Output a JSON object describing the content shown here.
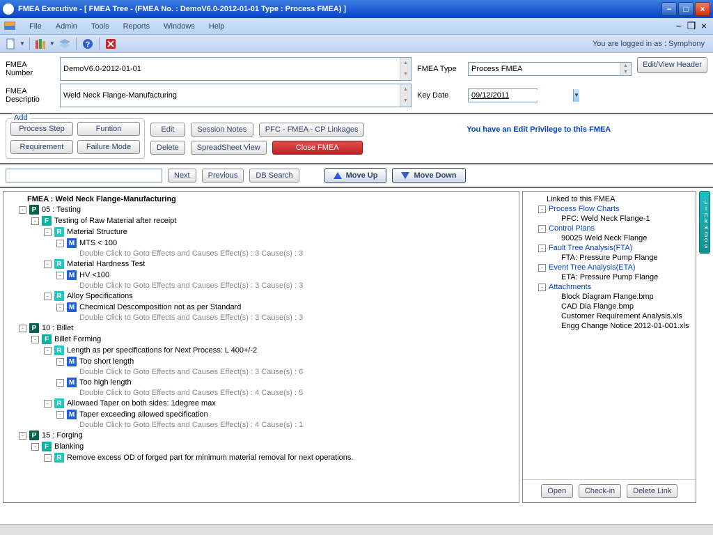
{
  "window": {
    "title": "FMEA Executive - [ FMEA Tree - (FMEA No. : DemoV6.0-2012-01-01  Type : Process FMEA) ]"
  },
  "menu": {
    "items": [
      "File",
      "Admin",
      "Tools",
      "Reports",
      "Windows",
      "Help"
    ]
  },
  "toolbar": {
    "login_status": "You are logged in as : Symphony"
  },
  "header": {
    "labels": {
      "fmea_number": "FMEA Number",
      "fmea_descriptio": "FMEA Descriptio",
      "fmea_type": "FMEA Type",
      "key_date": "Key Date"
    },
    "fmea_number": "DemoV6.0-2012-01-01",
    "fmea_descriptio": "Weld Neck Flange-Manufacturing",
    "fmea_type": "Process FMEA",
    "key_date": "09/12/2011",
    "edit_view_header": "Edit/View Header"
  },
  "actions": {
    "add_legend": "Add",
    "process_step": "Process Step",
    "funtion": "Funtion",
    "requirement": "Requirement",
    "failure_mode": "Failure Mode",
    "edit": "Edit",
    "delete": "Delete",
    "session_notes": "Session Notes",
    "pfc_linkages": "PFC - FMEA - CP Linkages",
    "spreadsheet_view": "SpreadSheet View",
    "close_fmea": "Close FMEA",
    "priv_msg": "You have an Edit Privilege to this FMEA"
  },
  "search": {
    "placeholder": "",
    "next": "Next",
    "previous": "Previous",
    "db_search": "DB Search",
    "move_up": "Move Up",
    "move_down": "Move Down"
  },
  "tree": {
    "root": "FMEA : Weld Neck Flange-Manufacturing",
    "nodes": [
      {
        "pm": "-",
        "ind": 1,
        "b": "P",
        "t": "05 : Testing"
      },
      {
        "pm": "-",
        "ind": 2,
        "b": "F",
        "t": "Testing of Raw Material after receipt"
      },
      {
        "pm": "-",
        "ind": 3,
        "b": "R",
        "t": "Material Structure"
      },
      {
        "pm": "-",
        "ind": 4,
        "b": "M",
        "t": "MTS < 100"
      },
      {
        "pm": "",
        "ind": 5,
        "b": "",
        "t": "Double Click to Goto Effects and Causes Effect(s) : 3 Cause(s) : 3",
        "grey": true
      },
      {
        "pm": "-",
        "ind": 3,
        "b": "R",
        "t": "Material Hardness Test"
      },
      {
        "pm": "-",
        "ind": 4,
        "b": "M",
        "t": "HV <100"
      },
      {
        "pm": "",
        "ind": 5,
        "b": "",
        "t": "Double Click to Goto Effects and Causes Effect(s) : 3 Cause(s) : 3",
        "grey": true
      },
      {
        "pm": "-",
        "ind": 3,
        "b": "R",
        "t": "Alloy Specifications"
      },
      {
        "pm": "-",
        "ind": 4,
        "b": "M",
        "t": "Checmical Descomposition not as per  Standard"
      },
      {
        "pm": "",
        "ind": 5,
        "b": "",
        "t": "Double Click to Goto Effects and Causes Effect(s) : 3 Cause(s) : 3",
        "grey": true
      },
      {
        "pm": "-",
        "ind": 1,
        "b": "P",
        "t": "10 : Billet"
      },
      {
        "pm": "-",
        "ind": 2,
        "b": "F",
        "t": "Billet Forming"
      },
      {
        "pm": "-",
        "ind": 3,
        "b": "R",
        "t": "Length as per specifications for Next Process: L 400+/-2"
      },
      {
        "pm": "-",
        "ind": 4,
        "b": "M",
        "t": "Too short length"
      },
      {
        "pm": "",
        "ind": 5,
        "b": "",
        "t": "Double Click to Goto Effects and Causes Effect(s) : 3 Cause(s) : 6",
        "grey": true
      },
      {
        "pm": "-",
        "ind": 4,
        "b": "M",
        "t": "Too high length"
      },
      {
        "pm": "",
        "ind": 5,
        "b": "",
        "t": "Double Click to Goto Effects and Causes Effect(s) : 4 Cause(s) : 5",
        "grey": true
      },
      {
        "pm": "-",
        "ind": 3,
        "b": "R",
        "t": "Allowaed Taper on both sides: 1degree max"
      },
      {
        "pm": "-",
        "ind": 4,
        "b": "M",
        "t": "Taper exceeding allowed specification"
      },
      {
        "pm": "",
        "ind": 5,
        "b": "",
        "t": "Double Click to Goto Effects and Causes Effect(s) : 4 Cause(s) : 1",
        "grey": true
      },
      {
        "pm": "-",
        "ind": 1,
        "b": "P",
        "t": "15 : Forging"
      },
      {
        "pm": "-",
        "ind": 2,
        "b": "F",
        "t": "Blanking"
      },
      {
        "pm": "-",
        "ind": 3,
        "b": "R",
        "t": "Remove excess OD of forged part for minimum material removal for next operations."
      }
    ]
  },
  "links": {
    "title": "Linked to this FMEA",
    "sections": [
      {
        "pm": "-",
        "label": "Process Flow Charts",
        "link": true,
        "children": [
          "PFC: Weld Neck Flange-1"
        ]
      },
      {
        "pm": "-",
        "label": "Control Plans",
        "link": true,
        "children": [
          "90025 Weld Neck Flange"
        ]
      },
      {
        "pm": "-",
        "label": "Fault Tree Analysis(FTA)",
        "link": true,
        "children": [
          "FTA: Pressure Pump Flange"
        ]
      },
      {
        "pm": "-",
        "label": "Event Tree Analysis(ETA)",
        "link": true,
        "children": [
          "ETA: Pressure Pump Flange"
        ]
      },
      {
        "pm": "-",
        "label": "Attachments",
        "link": true,
        "children": [
          "Block Diagram Flange.bmp",
          "CAD Dia Flange.bmp",
          "Customer Requirement Analysis.xls",
          "Engg Change Notice 2012-01-001.xls"
        ]
      }
    ],
    "buttons": {
      "open": "Open",
      "checkin": "Check-in",
      "delete_link": "Delete Link"
    },
    "tab": "Linkages"
  }
}
